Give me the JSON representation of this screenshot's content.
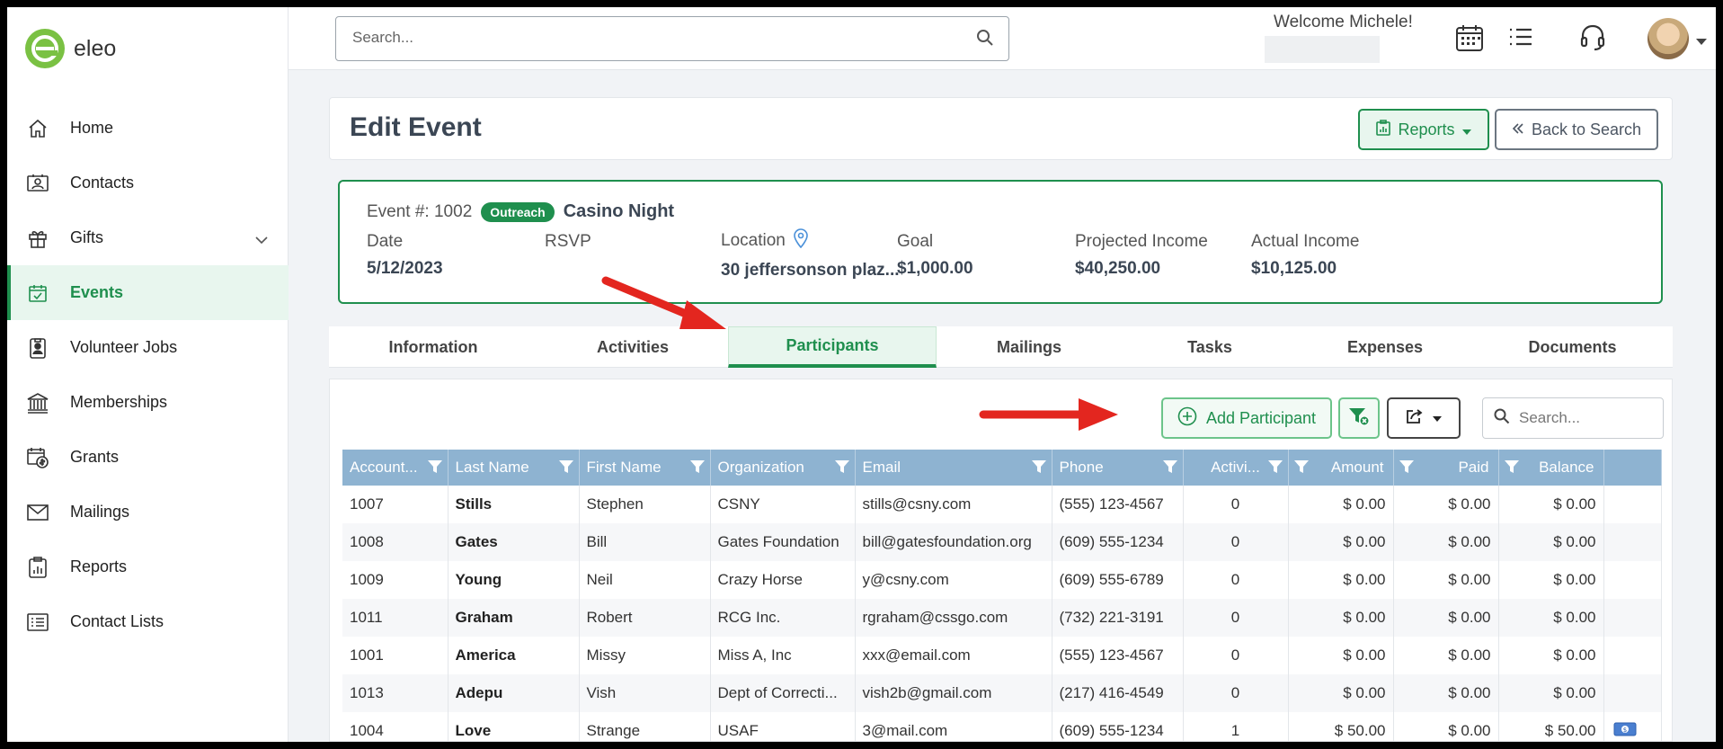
{
  "app": {
    "name": "eleo"
  },
  "sidebar": {
    "items": [
      {
        "label": "Home",
        "icon": "home-icon"
      },
      {
        "label": "Contacts",
        "icon": "contact-card-icon"
      },
      {
        "label": "Gifts",
        "icon": "gift-icon"
      },
      {
        "label": "Events",
        "icon": "calendar-check-icon",
        "active": true
      },
      {
        "label": "Volunteer Jobs",
        "icon": "badge-person-icon"
      },
      {
        "label": "Memberships",
        "icon": "bank-icon"
      },
      {
        "label": "Grants",
        "icon": "grants-icon"
      },
      {
        "label": "Mailings",
        "icon": "envelope-icon"
      },
      {
        "label": "Reports",
        "icon": "report-chart-icon"
      },
      {
        "label": "Contact Lists",
        "icon": "list-icon"
      }
    ]
  },
  "topbar": {
    "search_placeholder": "Search...",
    "welcome": "Welcome Michele!"
  },
  "header": {
    "title": "Edit Event",
    "reports_label": "Reports",
    "back_label": "Back to Search"
  },
  "event": {
    "number_label": "Event #: 1002",
    "badge": "Outreach",
    "name": "Casino Night",
    "fields": [
      {
        "label": "Date",
        "value": "5/12/2023"
      },
      {
        "label": "RSVP",
        "value": ""
      },
      {
        "label": "Location",
        "value": "30 jeffersonson plaz..."
      },
      {
        "label": "Goal",
        "value": "$1,000.00"
      },
      {
        "label": "Projected Income",
        "value": "$40,250.00"
      },
      {
        "label": "Actual Income",
        "value": "$10,125.00"
      }
    ]
  },
  "tabs": [
    "Information",
    "Activities",
    "Participants",
    "Mailings",
    "Tasks",
    "Expenses",
    "Documents"
  ],
  "active_tab": "Participants",
  "toolbar": {
    "add_label": "Add Participant",
    "search_placeholder": "Search..."
  },
  "grid": {
    "columns": [
      "Account...",
      "Last Name",
      "First Name",
      "Organization",
      "Email",
      "Phone",
      "Activi...",
      "Amount",
      "Paid",
      "Balance"
    ],
    "rows": [
      [
        "1007",
        "Stills",
        "Stephen",
        "CSNY",
        "stills@csny.com",
        "(555) 123-4567",
        "0",
        "$ 0.00",
        "$ 0.00",
        "$ 0.00"
      ],
      [
        "1008",
        "Gates",
        "Bill",
        "Gates Foundation",
        "bill@gatesfoundation.org",
        "(609) 555-1234",
        "0",
        "$ 0.00",
        "$ 0.00",
        "$ 0.00"
      ],
      [
        "1009",
        "Young",
        "Neil",
        "Crazy Horse",
        "y@csny.com",
        "(609) 555-6789",
        "0",
        "$ 0.00",
        "$ 0.00",
        "$ 0.00"
      ],
      [
        "1011",
        "Graham",
        "Robert",
        "RCG Inc.",
        "rgraham@cssgo.com",
        "(732) 221-3191",
        "0",
        "$ 0.00",
        "$ 0.00",
        "$ 0.00"
      ],
      [
        "1001",
        "America",
        "Missy",
        "Miss A, Inc",
        "xxx@email.com",
        "(555) 123-4567",
        "0",
        "$ 0.00",
        "$ 0.00",
        "$ 0.00"
      ],
      [
        "1013",
        "Adepu",
        "Vish",
        "Dept of Correcti...",
        "vish2b@gmail.com",
        "(217) 416-4549",
        "0",
        "$ 0.00",
        "$ 0.00",
        "$ 0.00"
      ],
      [
        "1004",
        "Love",
        "Strange",
        "USAF",
        "3@mail.com",
        "(609) 555-1234",
        "1",
        "$ 50.00",
        "$ 0.00",
        "$ 50.00"
      ]
    ]
  },
  "colors": {
    "brand_green": "#1f8f4e",
    "header_blue": "#8eb3d1",
    "annotation_red": "#e3261f"
  }
}
